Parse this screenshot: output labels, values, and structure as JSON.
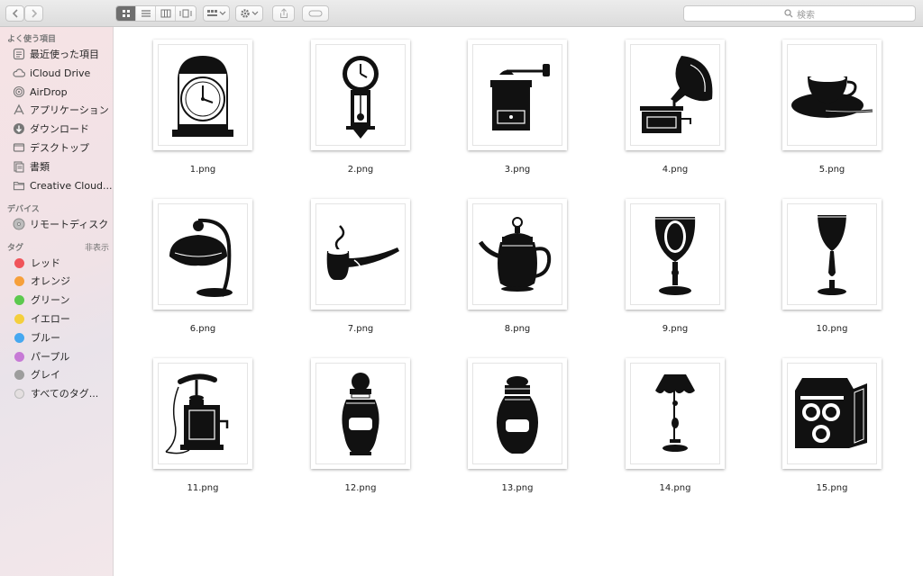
{
  "search": {
    "placeholder": "検索"
  },
  "sidebar": {
    "favorites_header": "よく使う項目",
    "favorites": [
      {
        "label": "最近使った項目",
        "icon": "recents-icon"
      },
      {
        "label": "iCloud Drive",
        "icon": "icloud-icon"
      },
      {
        "label": "AirDrop",
        "icon": "airdrop-icon"
      },
      {
        "label": "アプリケーション",
        "icon": "applications-icon"
      },
      {
        "label": "ダウンロード",
        "icon": "downloads-icon"
      },
      {
        "label": "デスクトップ",
        "icon": "desktop-icon"
      },
      {
        "label": "書類",
        "icon": "documents-icon"
      },
      {
        "label": "Creative Cloud...",
        "icon": "folder-icon"
      }
    ],
    "devices_header": "デバイス",
    "devices": [
      {
        "label": "リモートディスク",
        "icon": "remote-disc-icon"
      }
    ],
    "tags_header": "タグ",
    "tags_hide": "非表示",
    "tags": [
      {
        "label": "レッド",
        "color": "#f0545a"
      },
      {
        "label": "オレンジ",
        "color": "#f6a03b"
      },
      {
        "label": "グリーン",
        "color": "#5cc94e"
      },
      {
        "label": "イエロー",
        "color": "#f4cf3d"
      },
      {
        "label": "ブルー",
        "color": "#46a8f0"
      },
      {
        "label": "パープル",
        "color": "#c77ad6"
      },
      {
        "label": "グレイ",
        "color": "#9d9d9d"
      },
      {
        "label": "すべてのタグ...",
        "color": "#dcdcdc"
      }
    ]
  },
  "files": [
    {
      "name": "1.png",
      "icon": "mantel-clock-icon"
    },
    {
      "name": "2.png",
      "icon": "pendulum-clock-icon"
    },
    {
      "name": "3.png",
      "icon": "coffee-grinder-icon"
    },
    {
      "name": "4.png",
      "icon": "gramophone-icon"
    },
    {
      "name": "5.png",
      "icon": "teacup-icon"
    },
    {
      "name": "6.png",
      "icon": "desk-lamp-icon"
    },
    {
      "name": "7.png",
      "icon": "pipe-icon"
    },
    {
      "name": "8.png",
      "icon": "teapot-icon"
    },
    {
      "name": "9.png",
      "icon": "goblet-icon"
    },
    {
      "name": "10.png",
      "icon": "wine-glass-icon"
    },
    {
      "name": "11.png",
      "icon": "telephone-icon"
    },
    {
      "name": "12.png",
      "icon": "tall-jar-icon"
    },
    {
      "name": "13.png",
      "icon": "round-jar-icon"
    },
    {
      "name": "14.png",
      "icon": "floor-lamp-icon"
    },
    {
      "name": "15.png",
      "icon": "camera-icon"
    }
  ]
}
